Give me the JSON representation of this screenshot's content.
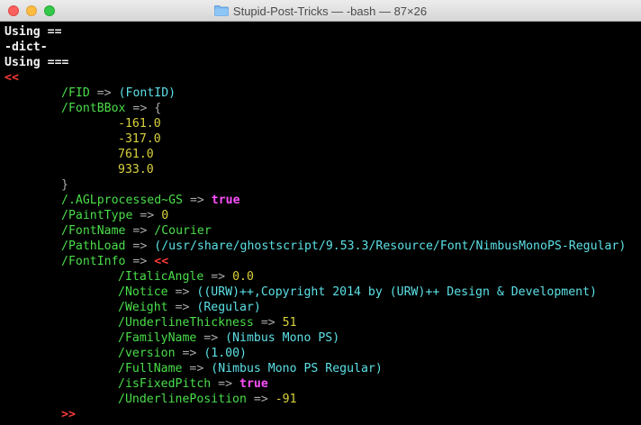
{
  "window": {
    "title": "Stupid-Post-Tricks — -bash — 87×26"
  },
  "terminal": {
    "l1": "Using ==",
    "l2": "-dict-",
    "l3": "Using ===",
    "open_dict": "<<",
    "fid_key": "/FID",
    "fid_val": "(FontID)",
    "bbox_key": "/FontBBox",
    "arrow": "=>",
    "brace_open": "{",
    "bbox_vals": [
      "-161.0",
      "-317.0",
      "761.0",
      "933.0"
    ],
    "brace_close": "}",
    "agl_key": "/.AGLprocessed~GS",
    "agl_val": "true",
    "painttype_key": "/PaintType",
    "painttype_val": "0",
    "fontname_key": "/FontName",
    "fontname_val": "/Courier",
    "pathload_key": "/PathLoad",
    "pathload_val": "(/usr/share/ghostscript/9.53.3/Resource/Font/NimbusMonoPS-Regular)",
    "fontinfo_key": "/FontInfo",
    "fontinfo_open": "<<",
    "italic_key": "/ItalicAngle",
    "italic_val": "0.0",
    "notice_key": "/Notice",
    "notice_val": "((URW)++,Copyright 2014 by (URW)++ Design & Development)",
    "weight_key": "/Weight",
    "weight_val": "(Regular)",
    "ulthick_key": "/UnderlineThickness",
    "ulthick_val": "51",
    "family_key": "/FamilyName",
    "family_val": "(Nimbus Mono PS)",
    "version_key": "/version",
    "version_val": "(1.00)",
    "fullname_key": "/FullName",
    "fullname_val": "(Nimbus Mono PS Regular)",
    "fixed_key": "/isFixedPitch",
    "fixed_val": "true",
    "ulpos_key": "/UnderlinePosition",
    "ulpos_val": "-91",
    "fontinfo_close": ">>"
  },
  "colors": {
    "red": "#ff3a3a",
    "green": "#4ade4a",
    "cyan": "#5ce1e6",
    "yellow": "#d9d23d",
    "magenta": "#ff4fff"
  }
}
